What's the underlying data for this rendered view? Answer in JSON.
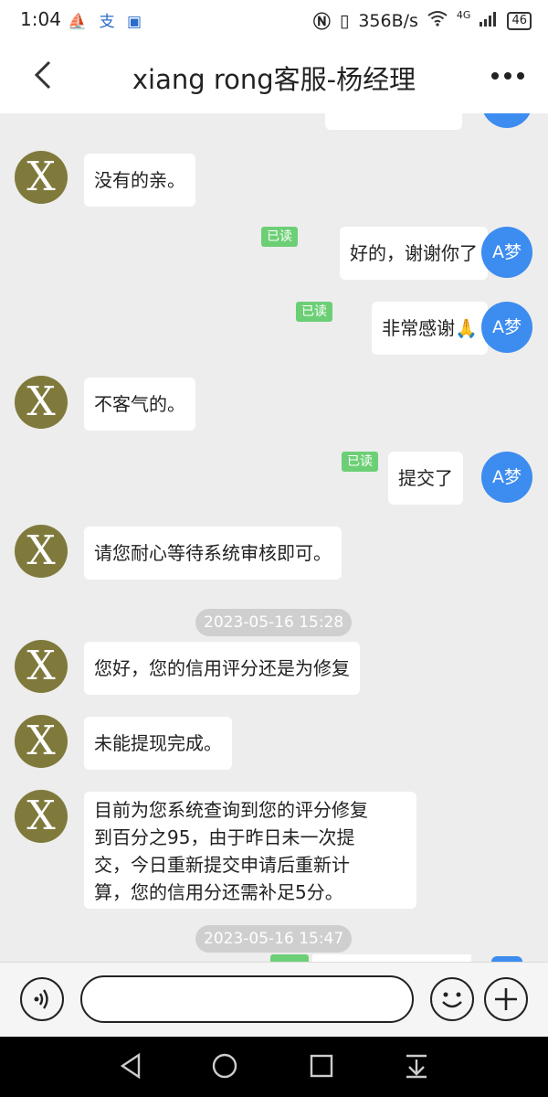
{
  "status_bar": {
    "time": "1:04",
    "left_icons": "⛵ 支 ▣",
    "network_speed": "356B/s",
    "signal": "4G",
    "battery": "46"
  },
  "header": {
    "title": "xiang rong客服-杨经理"
  },
  "chat": {
    "messages": [
      {
        "side": "left",
        "text": "没有的亲。"
      },
      {
        "side": "right",
        "read": "已读",
        "text": "好的，谢谢你了",
        "avatar": "A梦"
      },
      {
        "side": "right",
        "read": "已读",
        "text": "非常感谢🙏",
        "avatar": "A梦"
      },
      {
        "side": "left",
        "text": "不客气的。"
      },
      {
        "side": "right",
        "read": "已读",
        "text": "提交了",
        "avatar": "A梦"
      },
      {
        "side": "left",
        "text": "请您耐心等待系统审核即可。"
      },
      {
        "timestamp": "2023-05-16 15:28"
      },
      {
        "side": "left",
        "text": "您好，您的信用评分还是为修复"
      },
      {
        "side": "left",
        "text": "未能提现完成。"
      },
      {
        "side": "left",
        "lines": [
          "目前为您系统查询到您的评分修复",
          "到百分之95，由于昨日未一次提",
          "交，今日重新提交申请后重新计",
          "算，您的信用分还需补足5分。"
        ]
      },
      {
        "timestamp": "2023-05-16 15:47"
      }
    ],
    "left_avatar_letter": "X"
  },
  "colors": {
    "read_badge": "#6ccf76",
    "user_avatar": "#3d8cf0",
    "agent_avatar": "#7f7a3c"
  }
}
